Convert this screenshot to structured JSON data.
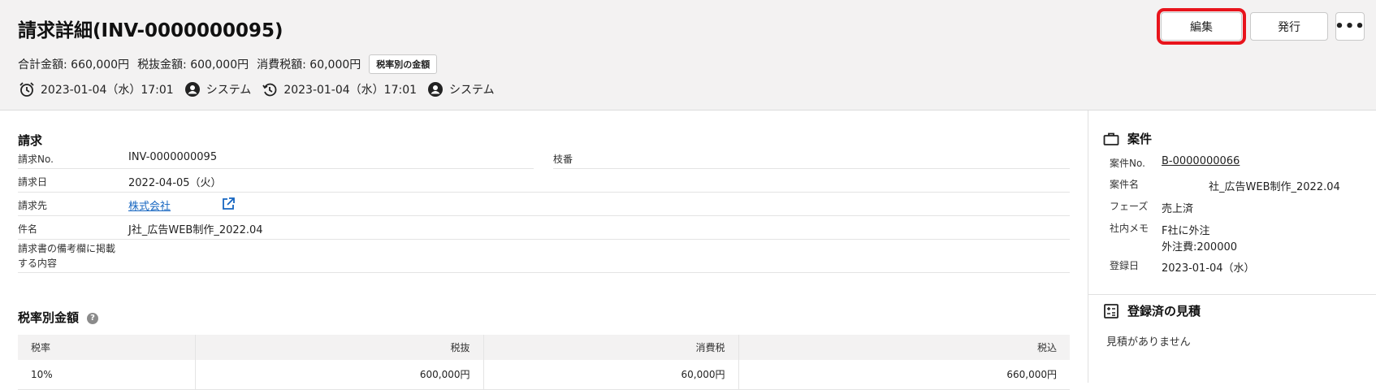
{
  "header": {
    "title": "請求詳細(INV-0000000095)",
    "summary": {
      "total": "合計金額: 660,000円",
      "subtotal": "税抜金額: 600,000円",
      "tax": "消費税額: 60,000円",
      "rate_button": "税率別の金額"
    },
    "meta": {
      "created_at": "2023-01-04（水）17:01",
      "created_by": "システム",
      "updated_at": "2023-01-04（水）17:01",
      "updated_by": "システム"
    },
    "actions": {
      "edit": "編集",
      "issue": "発行",
      "more": "•••"
    }
  },
  "invoice": {
    "section_title": "請求",
    "fields": {
      "no_label": "請求No.",
      "no_value": "INV-0000000095",
      "branch_label": "枝番",
      "date_label": "請求日",
      "date_value": "2022-04-05（火）",
      "client_label": "請求先",
      "client_value": "株式会社",
      "subject_label": "件名",
      "subject_value": "J社_広告WEB制作_2022.04",
      "remarks_label_1": "請求書の備考欄に掲載",
      "remarks_label_2": "する内容"
    }
  },
  "tax_table": {
    "section_title": "税率別金額",
    "help": "?",
    "columns": [
      "税率",
      "税抜",
      "消費税",
      "税込"
    ],
    "rows": [
      [
        "10%",
        "600,000円",
        "60,000円",
        "660,000円"
      ]
    ]
  },
  "side": {
    "case": {
      "title": "案件",
      "no_label": "案件No.",
      "no_value": "B-0000000066",
      "name_label": "案件名",
      "name_value": "社_広告WEB制作_2022.04",
      "phase_label": "フェーズ",
      "phase_value": "売上済",
      "memo_label": "社内メモ",
      "memo_line1": "F社に外注",
      "memo_line2": "外注費:200000",
      "reg_label": "登録日",
      "reg_value": "2023-01-04（水）"
    },
    "estimates": {
      "title": "登録済の見積",
      "empty": "見積がありません"
    }
  },
  "colors": {
    "header_bg": "#f3f2f2",
    "link": "#1565c0",
    "highlight": "#e8141c"
  }
}
